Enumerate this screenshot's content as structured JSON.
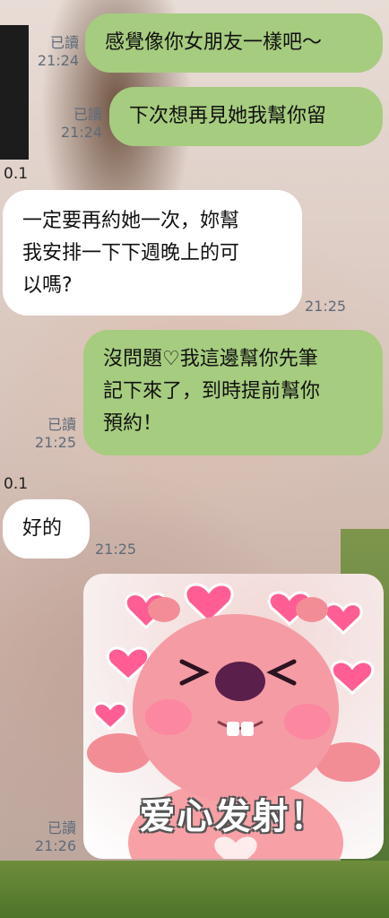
{
  "chat": {
    "messages": [
      {
        "id": "m1",
        "direction": "out",
        "text": "感覺像你女朋友一樣吧～",
        "read": "已讀",
        "time": "21:24"
      },
      {
        "id": "m2",
        "direction": "out",
        "text": "下次想再見她我幫你留",
        "read": "已讀",
        "time": "21:24"
      },
      {
        "id": "m3",
        "direction": "in",
        "sender": "0.1",
        "lines": [
          "一定要再約她一次，妳幫",
          "我安排一下下週晚上的可",
          "以嗎?"
        ],
        "time": "21:25"
      },
      {
        "id": "m4",
        "direction": "out",
        "lines": [
          "沒問題♡我這邊幫你先筆",
          "記下來了，到時提前幫你",
          "預約！"
        ],
        "read": "已讀",
        "time": "21:25"
      },
      {
        "id": "m5",
        "direction": "in",
        "sender": "0.1",
        "text": "好的",
        "time": "21:25"
      },
      {
        "id": "m6",
        "direction": "out",
        "type": "sticker",
        "caption": "爱心发射！",
        "read": "已讀",
        "time": "21:26"
      }
    ]
  },
  "colors": {
    "outgoing": "#a6cc7f",
    "incoming": "#ffffff",
    "meta": "#5f6b7a"
  }
}
